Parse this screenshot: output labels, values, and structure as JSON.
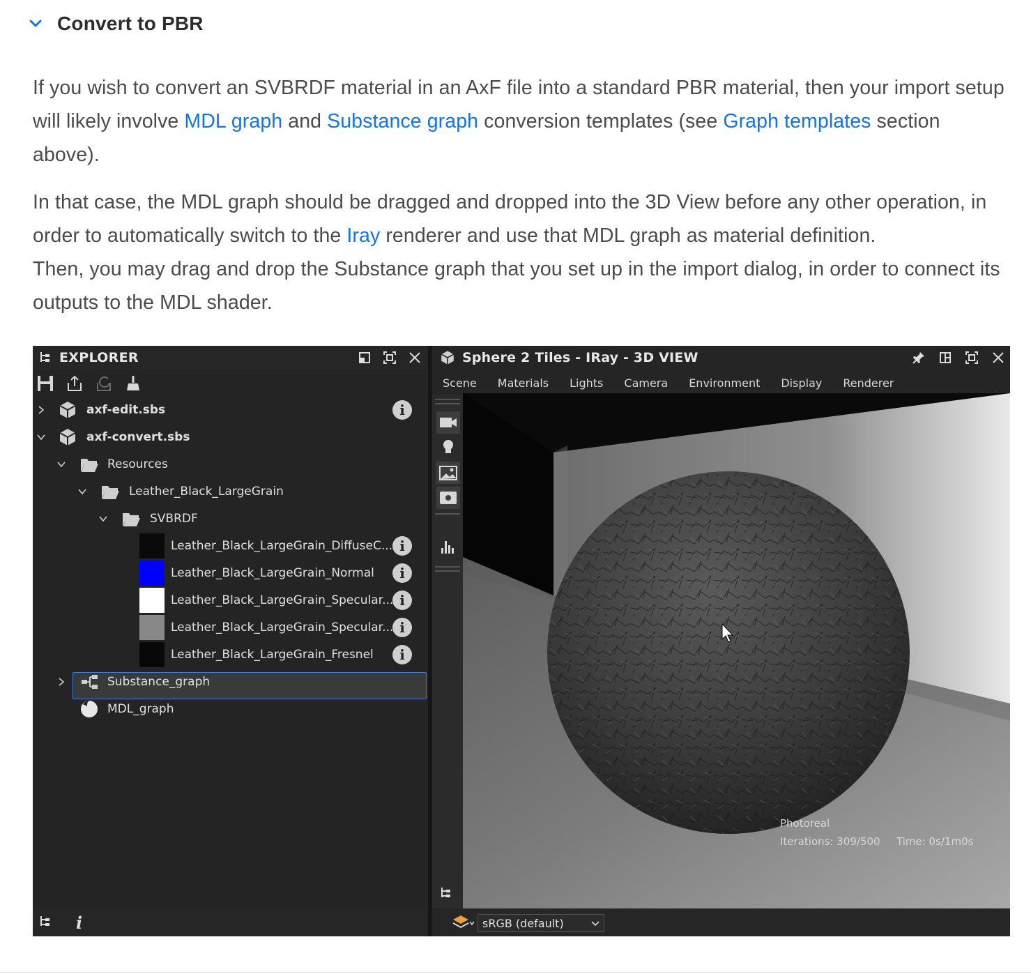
{
  "section": {
    "title": "Convert to PBR"
  },
  "para1": {
    "t1": "If you wish to convert an SVBRDF material in an AxF file into a standard PBR material, then your import setup will likely involve ",
    "link1": "MDL graph",
    "t2": " and ",
    "link2": "Substance graph",
    "t3": " conversion templates (see ",
    "link3": "Graph templates",
    "t4": " section above)."
  },
  "para2": {
    "t1": "In that case, the MDL graph should be dragged and dropped into the 3D View before any other operation, in order to automatically switch to the ",
    "link1": "Iray",
    "t2": " renderer and use that MDL graph as material definition.",
    "t3": "Then, you may drag and drop the Substance graph that you set up in the import dialog, in order to connect its outputs to the MDL shader."
  },
  "explorer": {
    "title": "EXPLORER",
    "tree": [
      {
        "label": "axf-edit.sbs"
      },
      {
        "label": "axf-convert.sbs"
      },
      {
        "label": "Resources"
      },
      {
        "label": "Leather_Black_LargeGrain"
      },
      {
        "label": "SVBRDF"
      },
      {
        "label": "Leather_Black_LargeGrain_DiffuseC..."
      },
      {
        "label": "Leather_Black_LargeGrain_Normal"
      },
      {
        "label": "Leather_Black_LargeGrain_Specular..."
      },
      {
        "label": "Leather_Black_LargeGrain_Specular..."
      },
      {
        "label": "Leather_Black_LargeGrain_Fresnel"
      },
      {
        "label": "Substance_graph"
      },
      {
        "label": "MDL_graph"
      }
    ],
    "swatch_colors": [
      "#0a0a0a",
      "#0000ff",
      "#ffffff",
      "#888888",
      "#080808"
    ],
    "info_glyph": "i",
    "footer_info_glyph": "i"
  },
  "view3d": {
    "title": "Sphere 2 Tiles - IRay - 3D VIEW",
    "menu": [
      "Scene",
      "Materials",
      "Lights",
      "Camera",
      "Environment",
      "Display",
      "Renderer"
    ],
    "stats": {
      "mode": "Photoreal",
      "iterations": "Iterations: 309/500",
      "time": "Time: 0s/1m0s"
    },
    "colorspace": "sRGB (default)"
  },
  "colors": {
    "link": "#1473e6",
    "accent_selection": "#3a7fd5"
  }
}
